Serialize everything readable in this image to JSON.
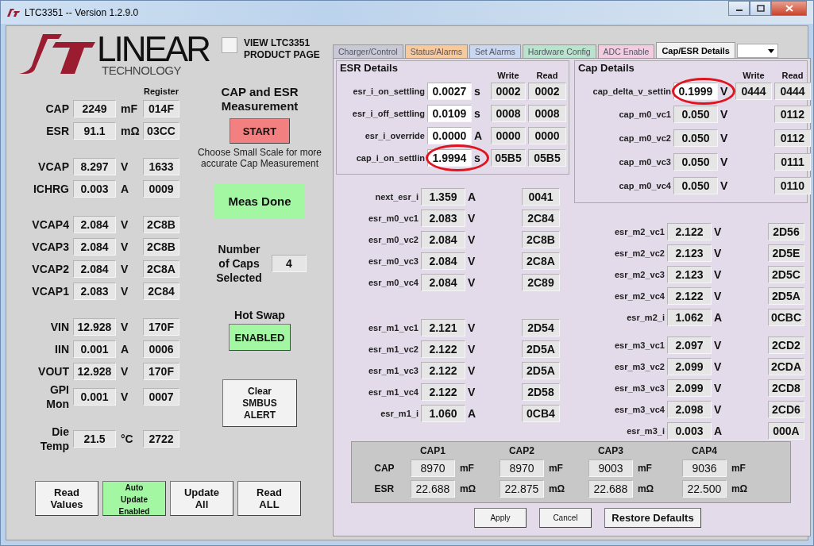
{
  "window": {
    "title": "LTC3351 -- Version 1.2.9.0"
  },
  "logo": {
    "word": "LINEAR",
    "tagline": "TECHNOLOGY"
  },
  "product_page": {
    "label": "VIEW LTC3351 PRODUCT PAGE",
    "checked": false
  },
  "readings": {
    "register_header": "Register",
    "groups": [
      [
        {
          "label": "CAP",
          "value": "2249",
          "unit": "mF",
          "register": "014F"
        },
        {
          "label": "ESR",
          "value": "91.1",
          "unit": "mΩ",
          "register": "03CC"
        }
      ],
      [
        {
          "label": "VCAP",
          "value": "8.297",
          "unit": "V",
          "register": "1633"
        },
        {
          "label": "ICHRG",
          "value": "0.003",
          "unit": "A",
          "register": "0009"
        }
      ],
      [
        {
          "label": "VCAP4",
          "value": "2.084",
          "unit": "V",
          "register": "2C8B"
        },
        {
          "label": "VCAP3",
          "value": "2.084",
          "unit": "V",
          "register": "2C8B"
        },
        {
          "label": "VCAP2",
          "value": "2.084",
          "unit": "V",
          "register": "2C8A"
        },
        {
          "label": "VCAP1",
          "value": "2.083",
          "unit": "V",
          "register": "2C84"
        }
      ],
      [
        {
          "label": "VIN",
          "value": "12.928",
          "unit": "V",
          "register": "170F"
        },
        {
          "label": "IIN",
          "value": "0.001",
          "unit": "A",
          "register": "0006"
        },
        {
          "label": "VOUT",
          "value": "12.928",
          "unit": "V",
          "register": "170F"
        },
        {
          "label": "GPI\nMon",
          "value": "0.001",
          "unit": "V",
          "register": "0007"
        }
      ],
      [
        {
          "label": "Die\nTemp",
          "value": "21.5",
          "unit": "°C",
          "register": "2722"
        }
      ]
    ]
  },
  "measurement": {
    "title": "CAP and ESR Measurement",
    "start_button": "START",
    "note": "Choose Small Scale for more accurate Cap Measurement",
    "status": "Meas Done",
    "caps_label": "Number of Caps Selected",
    "caps_value": "4",
    "hot_swap_label": "Hot Swap",
    "hot_swap_button": "ENABLED",
    "clear_button": "Clear SMBUS ALERT"
  },
  "bottom_buttons": [
    {
      "label": "Read Values",
      "active": false
    },
    {
      "label": "Auto Update Enabled",
      "active": true
    },
    {
      "label": "Update All",
      "active": false
    },
    {
      "label": "Read ALL",
      "active": false
    }
  ],
  "tabs": [
    {
      "label": "Charger/Control",
      "color": "#c9c9d6",
      "selected": false
    },
    {
      "label": "Status/Alarms",
      "color": "#f7c99b",
      "selected": false
    },
    {
      "label": "Set Alarms",
      "color": "#c9d7f0",
      "selected": false
    },
    {
      "label": "Hardware Config",
      "color": "#b9e3cc",
      "selected": false
    },
    {
      "label": "ADC Enable",
      "color": "#f2cde0",
      "selected": false
    },
    {
      "label": "Cap/ESR Details",
      "color": "#f2f2f2",
      "selected": true
    }
  ],
  "esr_details": {
    "title": "ESR Details",
    "headers": [
      "Write",
      "Read"
    ],
    "settings": [
      {
        "label": "esr_i_on_settling",
        "value": "0.0027",
        "unit": "s",
        "write": "0002",
        "read": "0002",
        "highlighted": false
      },
      {
        "label": "esr_i_off_settling",
        "value": "0.0109",
        "unit": "s",
        "write": "0008",
        "read": "0008",
        "highlighted": false
      },
      {
        "label": "esr_i_override",
        "value": "0.0000",
        "unit": "A",
        "write": "0000",
        "read": "0000",
        "highlighted": false
      },
      {
        "label": "cap_i_on_settlin",
        "value": "1.9994",
        "unit": "s",
        "write": "05B5",
        "read": "05B5",
        "highlighted": true
      }
    ]
  },
  "cap_details": {
    "title": "Cap Details",
    "headers": [
      "Write",
      "Read"
    ],
    "settings": [
      {
        "label": "cap_delta_v_settin",
        "value": "0.1999",
        "unit": "V",
        "write": "0444",
        "read": "0444",
        "highlighted": true
      }
    ],
    "readings": [
      {
        "label": "cap_m0_vc1",
        "value": "0.050",
        "unit": "V",
        "read": "0112"
      },
      {
        "label": "cap_m0_vc2",
        "value": "0.050",
        "unit": "V",
        "read": "0112"
      },
      {
        "label": "cap_m0_vc3",
        "value": "0.050",
        "unit": "V",
        "read": "0111"
      },
      {
        "label": "cap_m0_vc4",
        "value": "0.050",
        "unit": "V",
        "read": "0110"
      }
    ]
  },
  "left_readings": [
    [
      {
        "label": "next_esr_i",
        "value": "1.359",
        "unit": "A",
        "read": "0041"
      },
      {
        "label": "esr_m0_vc1",
        "value": "2.083",
        "unit": "V",
        "read": "2C84"
      },
      {
        "label": "esr_m0_vc2",
        "value": "2.084",
        "unit": "V",
        "read": "2C8B"
      },
      {
        "label": "esr_m0_vc3",
        "value": "2.084",
        "unit": "V",
        "read": "2C8A"
      },
      {
        "label": "esr_m0_vc4",
        "value": "2.084",
        "unit": "V",
        "read": "2C89"
      }
    ],
    [
      {
        "label": "esr_m1_vc1",
        "value": "2.121",
        "unit": "V",
        "read": "2D54"
      },
      {
        "label": "esr_m1_vc2",
        "value": "2.122",
        "unit": "V",
        "read": "2D5A"
      },
      {
        "label": "esr_m1_vc3",
        "value": "2.122",
        "unit": "V",
        "read": "2D5A"
      },
      {
        "label": "esr_m1_vc4",
        "value": "2.122",
        "unit": "V",
        "read": "2D58"
      },
      {
        "label": "esr_m1_i",
        "value": "1.060",
        "unit": "A",
        "read": "0CB4"
      }
    ]
  ],
  "right_readings": [
    [
      {
        "label": "esr_m2_vc1",
        "value": "2.122",
        "unit": "V",
        "read": "2D56"
      },
      {
        "label": "esr_m2_vc2",
        "value": "2.123",
        "unit": "V",
        "read": "2D5E"
      },
      {
        "label": "esr_m2_vc3",
        "value": "2.123",
        "unit": "V",
        "read": "2D5C"
      },
      {
        "label": "esr_m2_vc4",
        "value": "2.122",
        "unit": "V",
        "read": "2D5A"
      },
      {
        "label": "esr_m2_i",
        "value": "1.062",
        "unit": "A",
        "read": "0CBC"
      }
    ],
    [
      {
        "label": "esr_m3_vc1",
        "value": "2.097",
        "unit": "V",
        "read": "2CD2"
      },
      {
        "label": "esr_m3_vc2",
        "value": "2.099",
        "unit": "V",
        "read": "2CDA"
      },
      {
        "label": "esr_m3_vc3",
        "value": "2.099",
        "unit": "V",
        "read": "2CD8"
      },
      {
        "label": "esr_m3_vc4",
        "value": "2.098",
        "unit": "V",
        "read": "2CD6"
      },
      {
        "label": "esr_m3_i",
        "value": "0.003",
        "unit": "A",
        "read": "000A"
      }
    ]
  ],
  "summary": {
    "columns": [
      "CAP1",
      "CAP2",
      "CAP3",
      "CAP4"
    ],
    "rows": [
      {
        "label": "CAP",
        "values": [
          {
            "value": "8970",
            "unit": "mF"
          },
          {
            "value": "8970",
            "unit": "mF"
          },
          {
            "value": "9003",
            "unit": "mF"
          },
          {
            "value": "9036",
            "unit": "mF"
          }
        ]
      },
      {
        "label": "ESR",
        "values": [
          {
            "value": "22.688",
            "unit": "mΩ"
          },
          {
            "value": "22.875",
            "unit": "mΩ"
          },
          {
            "value": "22.688",
            "unit": "mΩ"
          },
          {
            "value": "22.500",
            "unit": "mΩ"
          }
        ]
      }
    ]
  },
  "dialog_buttons": [
    {
      "label": "Apply",
      "emphasis": false
    },
    {
      "label": "Cancel",
      "emphasis": false
    },
    {
      "label": "Restore Defaults",
      "emphasis": true
    }
  ]
}
